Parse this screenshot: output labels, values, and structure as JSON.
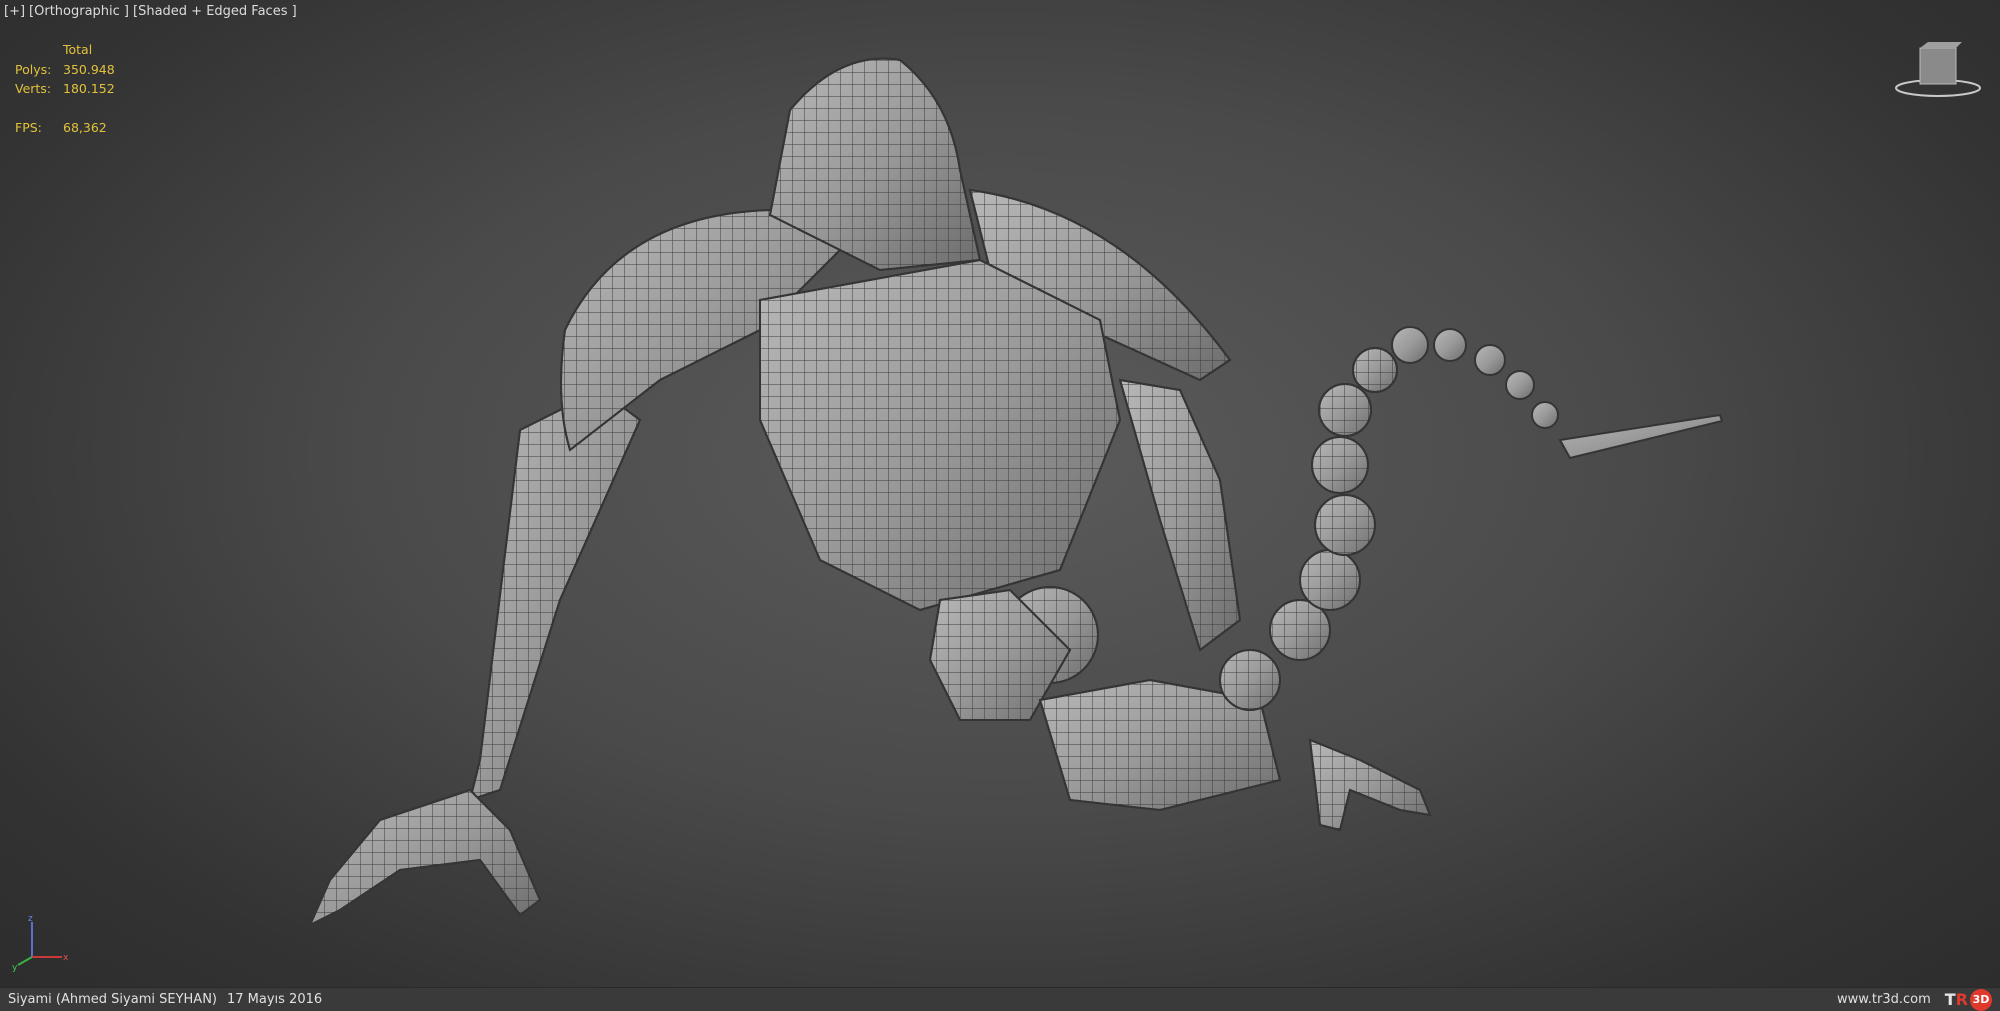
{
  "viewport": {
    "label_plus": "[+]",
    "label_view": "[Orthographic ]",
    "label_shading": "[Shaded + Edged Faces ]"
  },
  "stats": {
    "header": "Total",
    "polys_label": "Polys:",
    "polys_value": "350.948",
    "verts_label": "Verts:",
    "verts_value": "180.152",
    "fps_label": "FPS:",
    "fps_value": "68,362"
  },
  "viewcube": {
    "icon": "viewcube-icon"
  },
  "axis_gizmo": {
    "z_label": "z",
    "x_label": "x",
    "y_label": "y"
  },
  "status": {
    "author": "Siyami (Ahmed Siyami SEYHAN)",
    "date": "17 Mayıs 2016",
    "website": "www.tr3d.com",
    "logo_t": "T",
    "logo_r": "R",
    "logo_3d": "3D"
  },
  "colors": {
    "stats_text": "#e2c23c",
    "logo_red": "#e0382b",
    "mesh_fill": "#9a9a9a",
    "mesh_edge": "#3c3c3c"
  }
}
